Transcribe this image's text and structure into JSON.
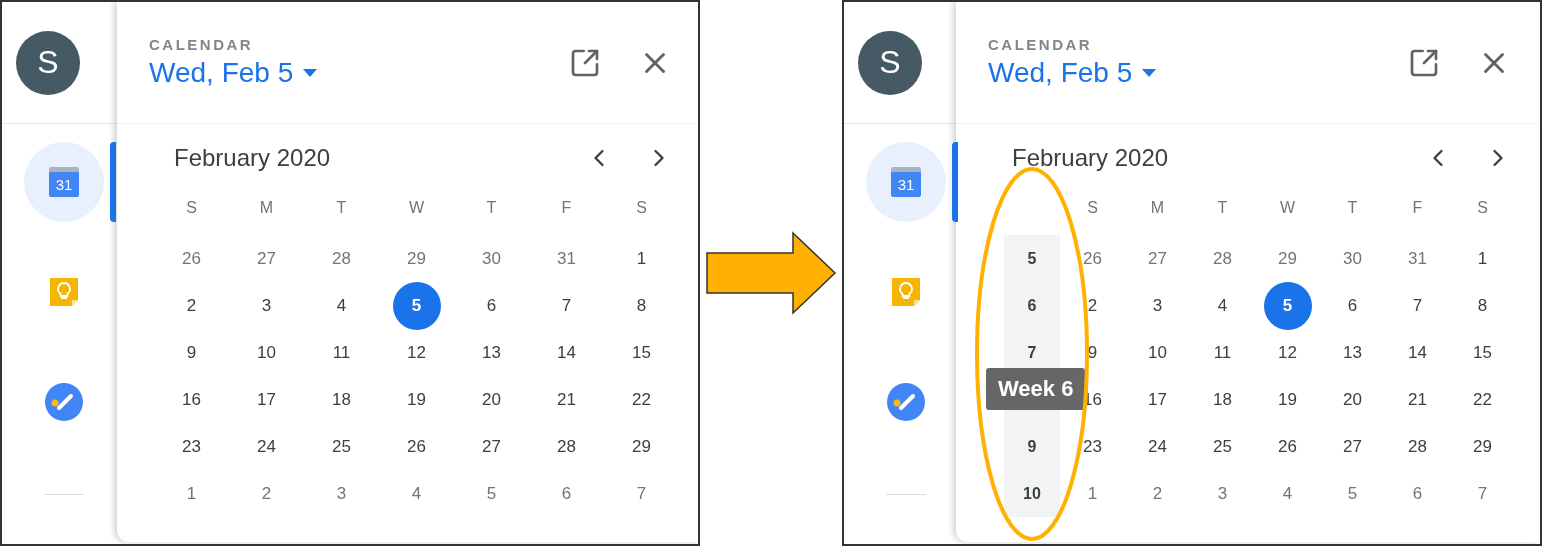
{
  "panels": [
    {
      "rail": {
        "avatar": "S",
        "items": [
          {
            "kind": "calendar",
            "label": "31",
            "selected": true
          },
          {
            "kind": "keep",
            "selected": false
          },
          {
            "kind": "tasks",
            "selected": false
          }
        ]
      },
      "popup": {
        "app_label": "CALENDAR",
        "date": "Wed, Feb 5",
        "month": "February 2020",
        "weekdays": [
          "S",
          "M",
          "T",
          "W",
          "T",
          "F",
          "S"
        ],
        "weeks": [
          {
            "days": [
              {
                "label": "26",
                "in_month": false,
                "selected": false
              },
              {
                "label": "27",
                "in_month": false,
                "selected": false
              },
              {
                "label": "28",
                "in_month": false,
                "selected": false
              },
              {
                "label": "29",
                "in_month": false,
                "selected": false
              },
              {
                "label": "30",
                "in_month": false,
                "selected": false
              },
              {
                "label": "31",
                "in_month": false,
                "selected": false
              },
              {
                "label": "1",
                "in_month": true,
                "selected": false
              }
            ]
          },
          {
            "days": [
              {
                "label": "2",
                "in_month": true,
                "selected": false
              },
              {
                "label": "3",
                "in_month": true,
                "selected": false
              },
              {
                "label": "4",
                "in_month": true,
                "selected": false
              },
              {
                "label": "5",
                "in_month": true,
                "selected": true
              },
              {
                "label": "6",
                "in_month": true,
                "selected": false
              },
              {
                "label": "7",
                "in_month": true,
                "selected": false
              },
              {
                "label": "8",
                "in_month": true,
                "selected": false
              }
            ]
          },
          {
            "days": [
              {
                "label": "9",
                "in_month": true,
                "selected": false
              },
              {
                "label": "10",
                "in_month": true,
                "selected": false
              },
              {
                "label": "11",
                "in_month": true,
                "selected": false
              },
              {
                "label": "12",
                "in_month": true,
                "selected": false
              },
              {
                "label": "13",
                "in_month": true,
                "selected": false
              },
              {
                "label": "14",
                "in_month": true,
                "selected": false
              },
              {
                "label": "15",
                "in_month": true,
                "selected": false
              }
            ]
          },
          {
            "days": [
              {
                "label": "16",
                "in_month": true,
                "selected": false
              },
              {
                "label": "17",
                "in_month": true,
                "selected": false
              },
              {
                "label": "18",
                "in_month": true,
                "selected": false
              },
              {
                "label": "19",
                "in_month": true,
                "selected": false
              },
              {
                "label": "20",
                "in_month": true,
                "selected": false
              },
              {
                "label": "21",
                "in_month": true,
                "selected": false
              },
              {
                "label": "22",
                "in_month": true,
                "selected": false
              }
            ]
          },
          {
            "days": [
              {
                "label": "23",
                "in_month": true,
                "selected": false
              },
              {
                "label": "24",
                "in_month": true,
                "selected": false
              },
              {
                "label": "25",
                "in_month": true,
                "selected": false
              },
              {
                "label": "26",
                "in_month": true,
                "selected": false
              },
              {
                "label": "27",
                "in_month": true,
                "selected": false
              },
              {
                "label": "28",
                "in_month": true,
                "selected": false
              },
              {
                "label": "29",
                "in_month": true,
                "selected": false
              }
            ]
          },
          {
            "days": [
              {
                "label": "1",
                "in_month": false,
                "selected": false
              },
              {
                "label": "2",
                "in_month": false,
                "selected": false
              },
              {
                "label": "3",
                "in_month": false,
                "selected": false
              },
              {
                "label": "4",
                "in_month": false,
                "selected": false
              },
              {
                "label": "5",
                "in_month": false,
                "selected": false
              },
              {
                "label": "6",
                "in_month": false,
                "selected": false
              },
              {
                "label": "7",
                "in_month": false,
                "selected": false
              }
            ]
          }
        ]
      }
    },
    {
      "rail": {
        "avatar": "S",
        "items": [
          {
            "kind": "calendar",
            "label": "31",
            "selected": true
          },
          {
            "kind": "keep",
            "selected": false
          },
          {
            "kind": "tasks",
            "selected": false
          }
        ]
      },
      "popup": {
        "app_label": "CALENDAR",
        "date": "Wed, Feb 5",
        "month": "February 2020",
        "weekdays": [
          "S",
          "M",
          "T",
          "W",
          "T",
          "F",
          "S"
        ],
        "tooltip": "Week 6",
        "highlight_week_column": true,
        "weeks": [
          {
            "number": "5",
            "days": [
              {
                "label": "26",
                "in_month": false,
                "selected": false
              },
              {
                "label": "27",
                "in_month": false,
                "selected": false
              },
              {
                "label": "28",
                "in_month": false,
                "selected": false
              },
              {
                "label": "29",
                "in_month": false,
                "selected": false
              },
              {
                "label": "30",
                "in_month": false,
                "selected": false
              },
              {
                "label": "31",
                "in_month": false,
                "selected": false
              },
              {
                "label": "1",
                "in_month": true,
                "selected": false
              }
            ]
          },
          {
            "number": "6",
            "days": [
              {
                "label": "2",
                "in_month": true,
                "selected": false
              },
              {
                "label": "3",
                "in_month": true,
                "selected": false
              },
              {
                "label": "4",
                "in_month": true,
                "selected": false
              },
              {
                "label": "5",
                "in_month": true,
                "selected": true
              },
              {
                "label": "6",
                "in_month": true,
                "selected": false
              },
              {
                "label": "7",
                "in_month": true,
                "selected": false
              },
              {
                "label": "8",
                "in_month": true,
                "selected": false
              }
            ]
          },
          {
            "number": "7",
            "days": [
              {
                "label": "9",
                "in_month": true,
                "selected": false
              },
              {
                "label": "10",
                "in_month": true,
                "selected": false
              },
              {
                "label": "11",
                "in_month": true,
                "selected": false
              },
              {
                "label": "12",
                "in_month": true,
                "selected": false
              },
              {
                "label": "13",
                "in_month": true,
                "selected": false
              },
              {
                "label": "14",
                "in_month": true,
                "selected": false
              },
              {
                "label": "15",
                "in_month": true,
                "selected": false
              }
            ]
          },
          {
            "days": [
              {
                "label": "16",
                "in_month": true,
                "selected": false
              },
              {
                "label": "17",
                "in_month": true,
                "selected": false
              },
              {
                "label": "18",
                "in_month": true,
                "selected": false
              },
              {
                "label": "19",
                "in_month": true,
                "selected": false
              },
              {
                "label": "20",
                "in_month": true,
                "selected": false
              },
              {
                "label": "21",
                "in_month": true,
                "selected": false
              },
              {
                "label": "22",
                "in_month": true,
                "selected": false
              }
            ]
          },
          {
            "number": "9",
            "days": [
              {
                "label": "23",
                "in_month": true,
                "selected": false
              },
              {
                "label": "24",
                "in_month": true,
                "selected": false
              },
              {
                "label": "25",
                "in_month": true,
                "selected": false
              },
              {
                "label": "26",
                "in_month": true,
                "selected": false
              },
              {
                "label": "27",
                "in_month": true,
                "selected": false
              },
              {
                "label": "28",
                "in_month": true,
                "selected": false
              },
              {
                "label": "29",
                "in_month": true,
                "selected": false
              }
            ]
          },
          {
            "number": "10",
            "days": [
              {
                "label": "1",
                "in_month": false,
                "selected": false
              },
              {
                "label": "2",
                "in_month": false,
                "selected": false
              },
              {
                "label": "3",
                "in_month": false,
                "selected": false
              },
              {
                "label": "4",
                "in_month": false,
                "selected": false
              },
              {
                "label": "5",
                "in_month": false,
                "selected": false
              },
              {
                "label": "6",
                "in_month": false,
                "selected": false
              },
              {
                "label": "7",
                "in_month": false,
                "selected": false
              }
            ]
          }
        ]
      }
    }
  ]
}
